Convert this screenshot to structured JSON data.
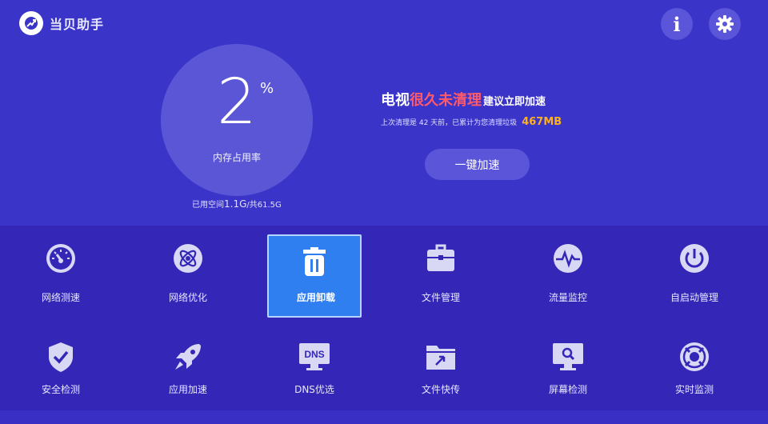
{
  "app": {
    "name": "当贝助手"
  },
  "header": {
    "info_icon": "info-icon",
    "settings_icon": "gear-icon"
  },
  "memory": {
    "percent": "2",
    "percent_sign": "%",
    "label": "内存占用率",
    "storage_prefix": "已用空间",
    "storage_used": "1.1G",
    "storage_mid": "/共",
    "storage_total": "61.5G"
  },
  "cleanup": {
    "headline_a": "电视",
    "headline_warn": "很久未清理",
    "headline_b": "建议立即加速",
    "sub_text": "上次清理是 42 天前，已累计为您清理垃圾",
    "amount": "467MB",
    "button": "一键加速",
    "warn_color": "#ff5a6a",
    "amount_color": "#ffb020"
  },
  "tools": [
    {
      "label": "网络测速",
      "icon": "speedometer-icon"
    },
    {
      "label": "网络优化",
      "icon": "atom-icon"
    },
    {
      "label": "应用卸载",
      "icon": "trash-icon",
      "selected": true
    },
    {
      "label": "文件管理",
      "icon": "toolbox-icon"
    },
    {
      "label": "流量监控",
      "icon": "pulse-icon"
    },
    {
      "label": "自启动管理",
      "icon": "power-icon"
    },
    {
      "label": "安全检测",
      "icon": "shield-check-icon"
    },
    {
      "label": "应用加速",
      "icon": "rocket-icon"
    },
    {
      "label": "DNS优选",
      "icon": "dns-monitor-icon",
      "badge": "DNS"
    },
    {
      "label": "文件快传",
      "icon": "folder-send-icon"
    },
    {
      "label": "屏幕检测",
      "icon": "monitor-search-icon"
    },
    {
      "label": "实时监测",
      "icon": "lifebuoy-icon"
    }
  ],
  "colors": {
    "background": "#3a34c9",
    "selected": "#2f7ff0",
    "accent_button": "#5a55d9"
  }
}
